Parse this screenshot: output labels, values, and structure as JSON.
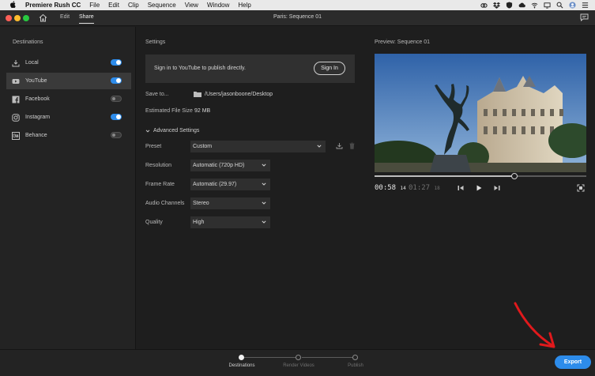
{
  "menubar": {
    "app_name": "Premiere Rush CC",
    "items": [
      "File",
      "Edit",
      "Clip",
      "Sequence",
      "View",
      "Window",
      "Help"
    ]
  },
  "titlebar": {
    "tabs": [
      {
        "label": "Edit"
      },
      {
        "label": "Share"
      }
    ],
    "window_title": "Paris: Sequence 01"
  },
  "sidebar": {
    "title": "Destinations",
    "items": [
      {
        "label": "Local",
        "enabled": true,
        "selected": false,
        "icon": "download-icon"
      },
      {
        "label": "YouTube",
        "enabled": true,
        "selected": true,
        "icon": "youtube-icon"
      },
      {
        "label": "Facebook",
        "enabled": false,
        "selected": false,
        "icon": "facebook-icon"
      },
      {
        "label": "Instagram",
        "enabled": true,
        "selected": false,
        "icon": "instagram-icon"
      },
      {
        "label": "Behance",
        "enabled": false,
        "selected": false,
        "icon": "behance-icon"
      }
    ]
  },
  "settings": {
    "title": "Settings",
    "signin_message": "Sign in to YouTube to publish directly.",
    "signin_button": "Sign In",
    "save_to_label": "Save to...",
    "save_to_path": "/Users/jasonboone/Desktop",
    "file_size_label": "Estimated File Size",
    "file_size_value": "92 MB",
    "advanced_label": "Advanced Settings",
    "fields": {
      "preset": {
        "label": "Preset",
        "value": "Custom"
      },
      "resolution": {
        "label": "Resolution",
        "value": "Automatic (720p HD)"
      },
      "frame_rate": {
        "label": "Frame Rate",
        "value": "Automatic (29.97)"
      },
      "audio_channels": {
        "label": "Audio Channels",
        "value": "Stereo"
      },
      "quality": {
        "label": "Quality",
        "value": "High"
      }
    }
  },
  "preview": {
    "title": "Preview: Sequence 01",
    "current_time": "00:58",
    "current_frames": "14",
    "duration_time": "01:27",
    "duration_frames": "18",
    "progress": 0.66
  },
  "bottom": {
    "steps": [
      {
        "label": "Destinations",
        "active": true
      },
      {
        "label": "Render Videos",
        "active": false
      },
      {
        "label": "Publish",
        "active": false
      }
    ],
    "export_label": "Export"
  },
  "colors": {
    "accent": "#2d8ceb",
    "annotation_arrow": "#e0191c"
  }
}
